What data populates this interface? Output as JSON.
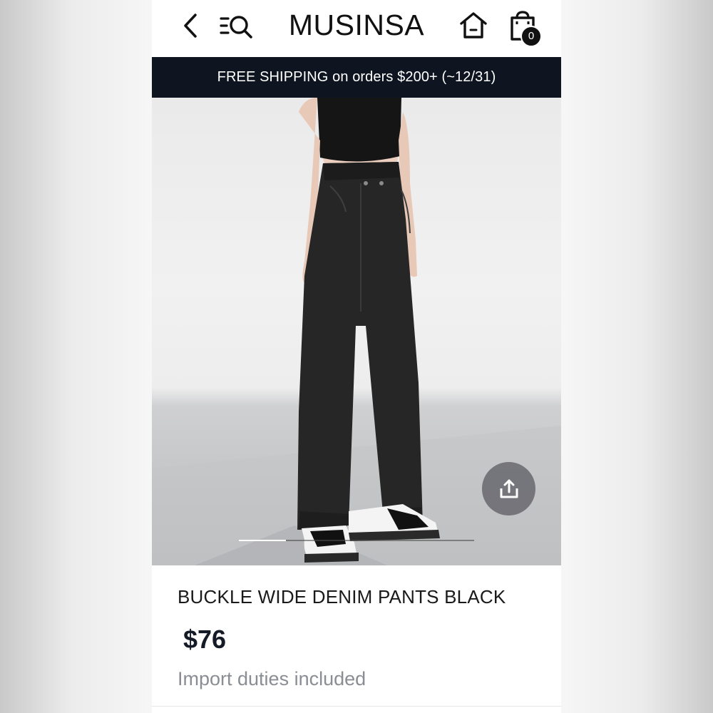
{
  "header": {
    "logo": "MUSINSA",
    "cart_count": "0",
    "icons": {
      "back": "chevron-left-icon",
      "menu": "menu-search-icon",
      "home": "home-icon",
      "cart": "shopping-bag-icon"
    }
  },
  "banner": {
    "text": "FREE SHIPPING on orders $200+ (~12/31)"
  },
  "gallery": {
    "image_progress": 0.2,
    "share_icon": "share-icon"
  },
  "product": {
    "title": "BUCKLE WIDE DENIM PANTS BLACK",
    "price": "$76",
    "duties_note": "Import duties included"
  },
  "colors": {
    "banner_bg": "#0f1520",
    "price": "#141a26",
    "muted_text": "#8a8d93"
  }
}
